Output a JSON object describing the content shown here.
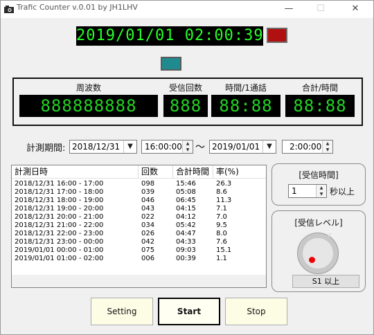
{
  "window": {
    "title": "Trafic Counter v.0.01 by JH1LHV",
    "minimize": "—",
    "maximize": "☐",
    "close": "✕"
  },
  "clock": {
    "datetime": "2019/01/01 02:00:39"
  },
  "colors": {
    "led_red": "#b01010",
    "led_teal": "#1f8b8f",
    "segment": "#22d622"
  },
  "panel": {
    "labels": {
      "frequency": "周波数",
      "receive_count": "受信回数",
      "time_per_call": "時間/1通話",
      "total_per_hour": "合計/時間"
    },
    "displays": {
      "frequency": "888888888",
      "receive_count": "888",
      "time_per_call": "88:88",
      "total_per_hour": "88:88"
    }
  },
  "measure": {
    "label": "計測期間:",
    "start_date": "2018/12/31",
    "start_time": "16:00:00",
    "tilde": "～",
    "end_date": "2019/01/01",
    "end_time": "2:00:00"
  },
  "table": {
    "headers": [
      "計測日時",
      "回数",
      "合計時間",
      "率(%)"
    ],
    "rows": [
      [
        "2018/12/31 16:00 - 17:00",
        "098",
        "15:46",
        "26.3"
      ],
      [
        "2018/12/31 17:00 - 18:00",
        "039",
        "05:08",
        "8.6"
      ],
      [
        "2018/12/31 18:00 - 19:00",
        "046",
        "06:45",
        "11.3"
      ],
      [
        "2018/12/31 19:00 - 20:00",
        "043",
        "04:15",
        "7.1"
      ],
      [
        "2018/12/31 20:00 - 21:00",
        "022",
        "04:12",
        "7.0"
      ],
      [
        "2018/12/31 21:00 - 22:00",
        "034",
        "05:42",
        "9.5"
      ],
      [
        "2018/12/31 22:00 - 23:00",
        "026",
        "04:47",
        "8.0"
      ],
      [
        "2018/12/31 23:00 - 00:00",
        "042",
        "04:33",
        "7.6"
      ],
      [
        "2019/01/01 00:00 - 01:00",
        "075",
        "09:03",
        "15.1"
      ],
      [
        "2019/01/01 01:00 - 02:00",
        "006",
        "00:39",
        "1.1"
      ]
    ]
  },
  "receive_time": {
    "title": "[受信時間]",
    "value": "1",
    "unit": "秒以上"
  },
  "receive_level": {
    "title": "[受信レベル]",
    "button": "S1 以上"
  },
  "buttons": {
    "setting": "Setting",
    "start": "Start",
    "stop": "Stop"
  }
}
